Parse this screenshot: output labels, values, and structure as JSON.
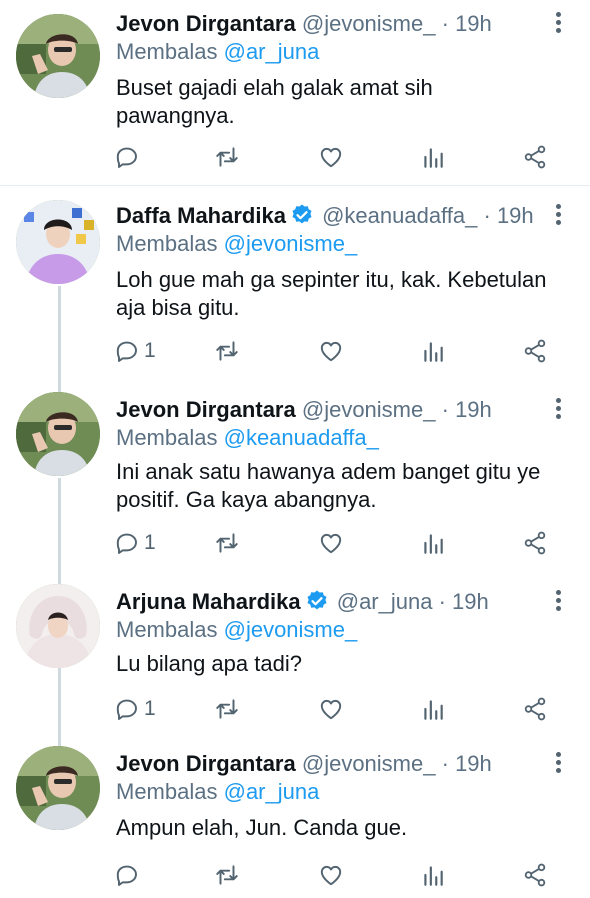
{
  "labels": {
    "reply_prefix": "Membalas"
  },
  "colors": {
    "link": "#1d9bf0",
    "secondary": "#5b7083",
    "thread_line": "#cfd9de",
    "verified": "#1d9bf0"
  },
  "icons": [
    "reply-icon",
    "retweet-icon",
    "like-icon",
    "stats-icon",
    "share-icon",
    "more-icon",
    "verified-badge-icon"
  ],
  "tweets": [
    {
      "name": "Jevon Dirgantara",
      "handle": "@jevonisme_",
      "dot": "·",
      "time": "19h",
      "verified": false,
      "reply_to": "@ar_juna",
      "text_lines": [
        "Buset gajadi elah galak amat sih",
        "pawangnya."
      ],
      "reply_count": ""
    },
    {
      "name": "Daffa Mahardika",
      "handle": "@keanuadaffa_",
      "dot": "·",
      "time": "19h",
      "verified": true,
      "reply_to": "@jevonisme_",
      "text_lines": [
        "Loh gue mah ga sepinter itu, kak. Kebetulan",
        "aja bisa gitu."
      ],
      "reply_count": "1"
    },
    {
      "name": "Jevon Dirgantara",
      "handle": "@jevonisme_",
      "dot": "·",
      "time": "19h",
      "verified": false,
      "reply_to": "@keanuadaffa_",
      "text_lines": [
        "Ini anak satu hawanya adem banget gitu ye",
        "positif. Ga kaya abangnya."
      ],
      "reply_count": "1"
    },
    {
      "name": "Arjuna Mahardika",
      "handle": "@ar_juna",
      "dot": "·",
      "time": "19h",
      "verified": true,
      "reply_to": "@jevonisme_",
      "text_lines": [
        "Lu bilang apa tadi?"
      ],
      "reply_count": "1"
    },
    {
      "name": "Jevon Dirgantara",
      "handle": "@jevonisme_",
      "dot": "·",
      "time": "19h",
      "verified": false,
      "reply_to": "@ar_juna",
      "text_lines": [
        "Ampun elah, Jun. Canda gue."
      ],
      "reply_count": ""
    }
  ]
}
